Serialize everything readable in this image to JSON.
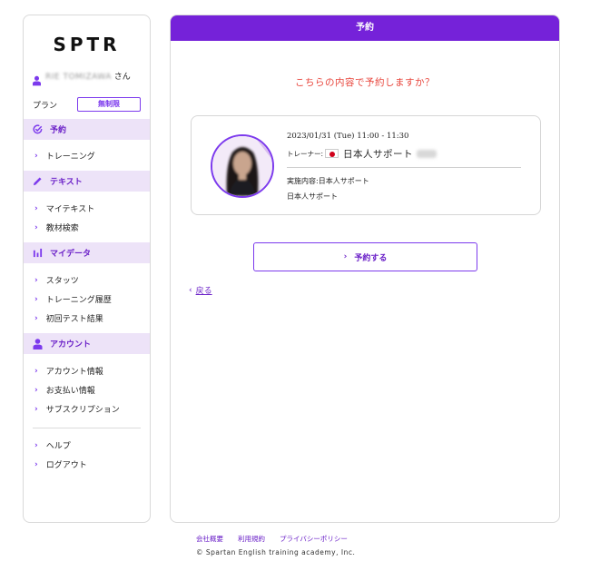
{
  "brand": {
    "logo": "SPTR"
  },
  "user": {
    "name": "RIE TOMIZAWA",
    "honorific": "さん"
  },
  "plan": {
    "label": "プラン",
    "value": "無制限"
  },
  "sidebar": {
    "sections": [
      {
        "title": "予約",
        "icon": "check-circle-icon",
        "items": [
          "トレーニング"
        ]
      },
      {
        "title": "テキスト",
        "icon": "pencil-icon",
        "items": [
          "マイテキスト",
          "教材検索"
        ]
      },
      {
        "title": "マイデータ",
        "icon": "bar-chart-icon",
        "items": [
          "スタッツ",
          "トレーニング履歴",
          "初回テスト結果"
        ]
      },
      {
        "title": "アカウント",
        "icon": "user-icon",
        "items": [
          "アカウント情報",
          "お支払い情報",
          "サブスクリプション"
        ]
      }
    ],
    "bottom_items": [
      "ヘルプ",
      "ログアウト"
    ]
  },
  "main": {
    "header": "予約",
    "question": "こちらの内容で予約しますか？",
    "booking": {
      "datetime": "2023/01/31 (Tue) 11:00 - 11:30",
      "trainer_label": "トレーナー:",
      "trainer_name": "日本人サポート",
      "course": "実施内容:日本人サポート",
      "course_sub": "日本人サポート"
    },
    "reserve_button": "予約する",
    "back_link": "戻る"
  },
  "footer": {
    "links": [
      "会社概要",
      "利用規約",
      "プライバシーポリシー"
    ],
    "copyright": "© Spartan English training academy, Inc."
  },
  "colors": {
    "accent": "#7522d9",
    "section_bg": "#ede3f8",
    "question": "#e8453c"
  }
}
